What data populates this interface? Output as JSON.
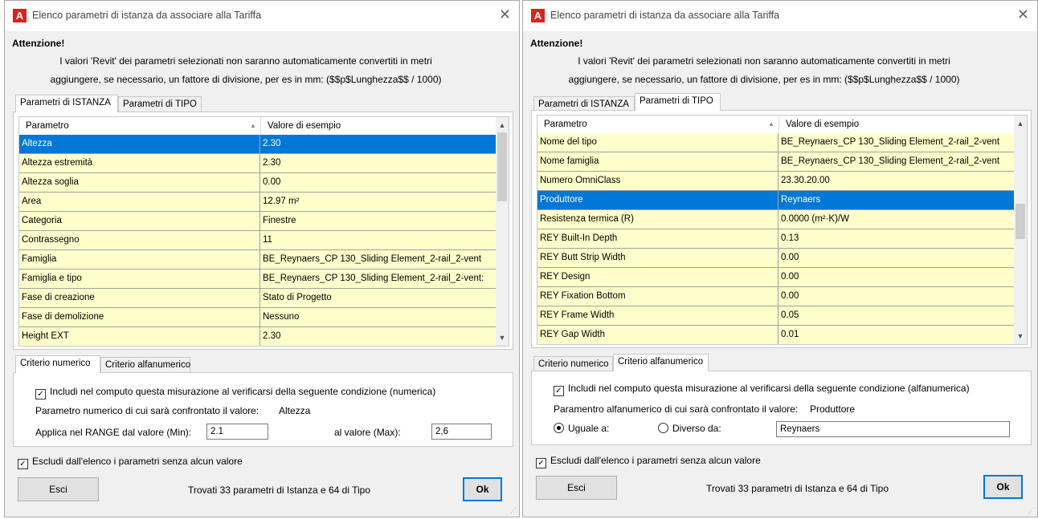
{
  "window_title": "Elenco parametri di istanza da associare alla Tariffa",
  "app_icon": "A",
  "warning": {
    "title": "Attenzione!",
    "line1": "I valori 'Revit' dei parametri selezionati non saranno automaticamente convertiti in metri",
    "line2": "aggiungere, se necessario, un fattore di divisione, per es in mm: ($$p$Lunghezza$$ / 1000)"
  },
  "tabs": {
    "istanza": "Parametri di ISTANZA",
    "tipo": "Parametri di TIPO"
  },
  "grid_headers": {
    "param": "Parametro",
    "value": "Valore di esempio"
  },
  "left": {
    "rows": [
      {
        "p": "Altezza",
        "v": "2.30",
        "selected": true
      },
      {
        "p": "Altezza estremità",
        "v": "2.30"
      },
      {
        "p": "Altezza soglia",
        "v": "0.00"
      },
      {
        "p": "Area",
        "v": "12.97 m²"
      },
      {
        "p": "Categoria",
        "v": "Finestre"
      },
      {
        "p": "Contrassegno",
        "v": "11"
      },
      {
        "p": "Famiglia",
        "v": "BE_Reynaers_CP 130_Sliding Element_2-rail_2-vent"
      },
      {
        "p": "Famiglia e tipo",
        "v": "BE_Reynaers_CP 130_Sliding Element_2-rail_2-vent:"
      },
      {
        "p": "Fase di creazione",
        "v": "Stato di Progetto"
      },
      {
        "p": "Fase di demolizione",
        "v": "Nessuno"
      },
      {
        "p": "Height EXT",
        "v": "2.30"
      }
    ],
    "criteria_tabs": {
      "numeric": "Criterio numerico",
      "alpha": "Criterio alfanumerico"
    },
    "include_label": "Includi nel computo questa misurazione al verificarsi della seguente condizione (numerica)",
    "param_compare_label": "Parametro numerico di cui sarà confrontato il valore:",
    "param_compare_value": "Altezza",
    "range_min_label": "Applica nel RANGE dal valore (Min):",
    "range_min_value": "2.1",
    "range_max_label": "al valore (Max):",
    "range_max_value": "2,6"
  },
  "right": {
    "rows": [
      {
        "p": "Nome del tipo",
        "v": "BE_Reynaers_CP 130_Sliding Element_2-rail_2-vent"
      },
      {
        "p": "Nome famiglia",
        "v": "BE_Reynaers_CP 130_Sliding Element_2-rail_2-vent"
      },
      {
        "p": "Numero OmniClass",
        "v": "23.30.20.00"
      },
      {
        "p": "Produttore",
        "v": "Reynaers",
        "selected": true
      },
      {
        "p": "Resistenza termica (R)",
        "v": "0.0000 (m²·K)/W"
      },
      {
        "p": "REY Built-In Depth",
        "v": "0.13"
      },
      {
        "p": "REY Butt Strip Width",
        "v": "0.00"
      },
      {
        "p": "REY Design",
        "v": "0.00"
      },
      {
        "p": "REY Fixation Bottom",
        "v": "0.00"
      },
      {
        "p": "REY Frame Width",
        "v": "0.05"
      },
      {
        "p": "REY Gap Width",
        "v": "0.01"
      }
    ],
    "criteria_tabs": {
      "numeric": "Criterio numerico",
      "alpha": "Criterio alfanumerico"
    },
    "include_label": "Includi nel computo questa misurazione al verificarsi della seguente condizione (alfanumerica)",
    "param_compare_label": "Paramentro alfanumerico di cui sarà confrontato il valore:",
    "param_compare_value": "Produttore",
    "equal_label": "Uguale a:",
    "different_label": "Diverso da:",
    "compare_value": "Reynaers"
  },
  "exclude_label": "Escludi dall'elenco i parametri senza alcun valore",
  "exit_label": "Esci",
  "status": "Trovati 33 parametri di Istanza e 64 di Tipo",
  "ok_label": "Ok",
  "colors": {
    "accent": "#0078d7",
    "row_bg": "#ffffcc",
    "app_icon": "#e0201c"
  }
}
